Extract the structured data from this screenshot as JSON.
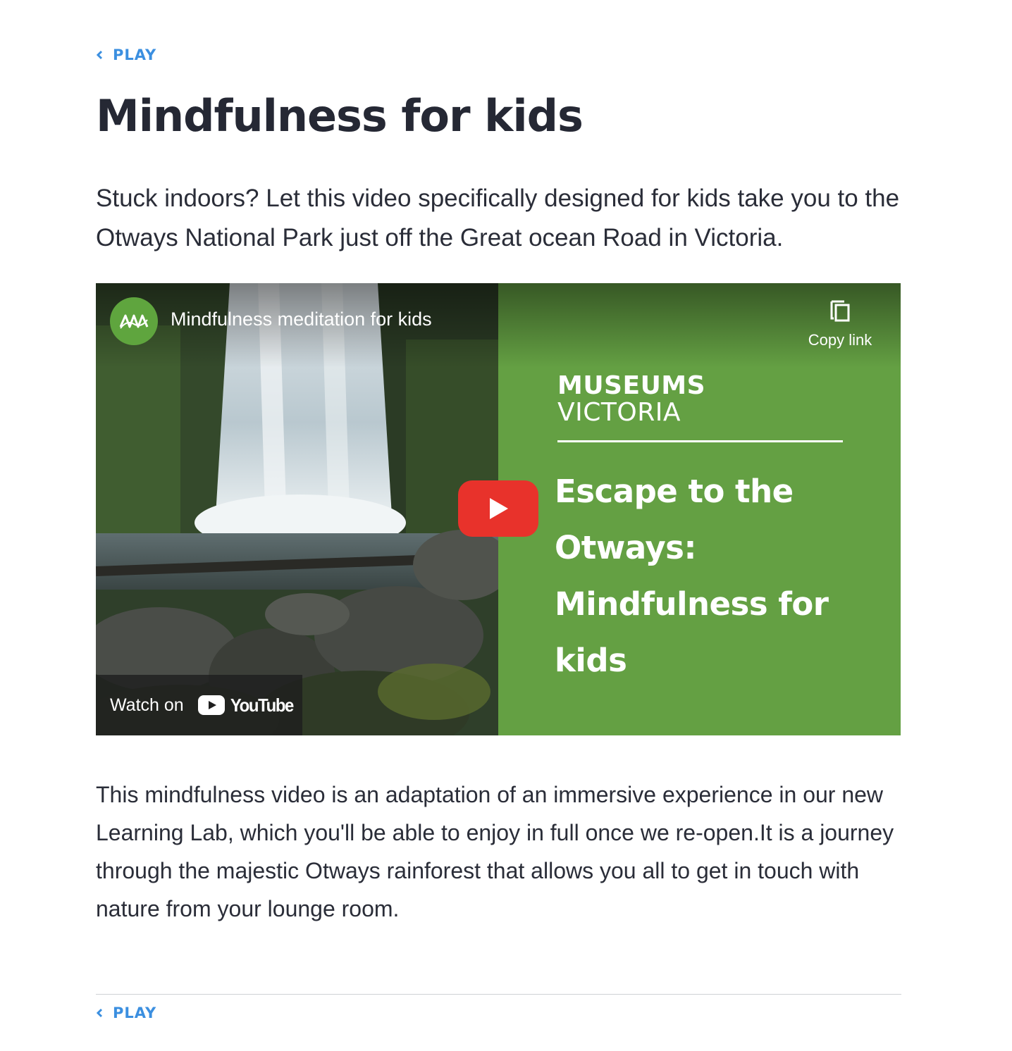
{
  "nav": {
    "back_label": "PLAY"
  },
  "page": {
    "title": "Mindfulness for kids",
    "intro": "Stuck indoors? Let this video specifically designed for kids take you to the Otways National Park just off the Great ocean Road in Victoria."
  },
  "video": {
    "title": "Mindfulness meditation for kids",
    "copy_link_label": "Copy link",
    "brand_line1": "MUSEUMS",
    "brand_line2": "VICTORIA",
    "promo_title": "Escape to the Otways: Mindfulness for kids",
    "watch_on_label": "Watch on",
    "youtube_word": "YouTube",
    "icons": [
      "museums-victoria-avatar-icon",
      "copy-icon",
      "play-icon",
      "youtube-logo-icon"
    ]
  },
  "content": {
    "body": "This mindfulness video is an adaptation of an immersive experience in our new Learning Lab, which you'll be able to enjoy in full once we re-open.It is a journey through the majestic Otways rainforest that allows you all to get in touch with nature from your lounge room."
  },
  "colors": {
    "link": "#3b8fe0",
    "heading": "#252834",
    "panel_green": "#64a043",
    "play_red": "#e8322b"
  }
}
